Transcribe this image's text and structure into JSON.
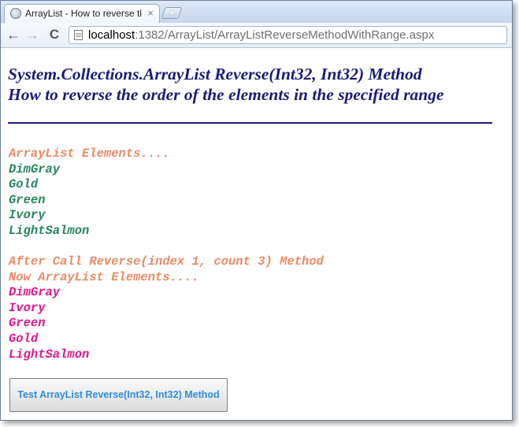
{
  "browser": {
    "tab_title": "ArrayList - How to reverse tl",
    "tab_close": "×",
    "new_tab": "+",
    "back": "←",
    "forward": "→",
    "reload": "C",
    "url_host": "localhost",
    "url_rest": ":1382/ArrayList/ArrayListReverseMethodWithRange.aspx"
  },
  "page": {
    "heading_line1": "System.Collections.ArrayList Reverse(Int32, Int32) Method",
    "heading_line2": "How to reverse the order of the elements in the specified range",
    "original_label": "ArrayList Elements....",
    "original_items": [
      "DimGray",
      "Gold",
      "Green",
      "Ivory",
      "LightSalmon"
    ],
    "after_label_1": "After Call Reverse(index 1, count 3) Method",
    "after_label_2": "Now ArrayList Elements....",
    "reversed_items": [
      "DimGray",
      "Ivory",
      "Green",
      "Gold",
      "LightSalmon"
    ],
    "button_label": "Test ArrayList Reverse(Int32, Int32) Method"
  },
  "colors": {
    "heading": "#1b1b7a",
    "label": "#e88a66",
    "original_items": "#24875a",
    "reversed_items": "#e0188c",
    "button_text": "#2f8de0"
  }
}
